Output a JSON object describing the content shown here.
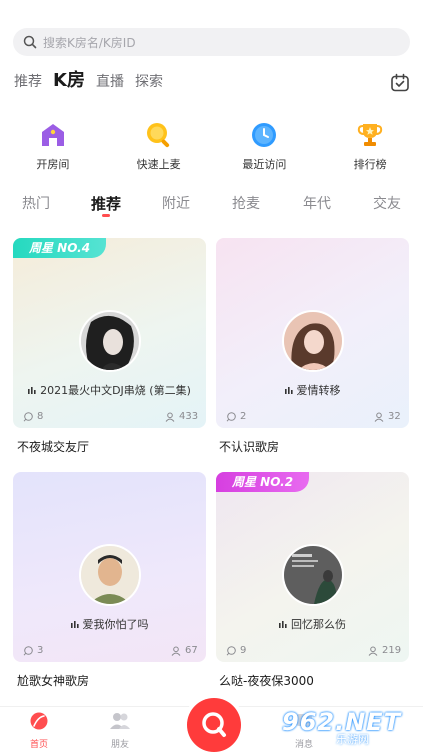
{
  "search": {
    "placeholder": "搜索K房名/K房ID"
  },
  "top_tabs": [
    "推荐",
    "K房",
    "直播",
    "探索"
  ],
  "quick_actions": [
    {
      "label": "开房间",
      "icon": "house-icon"
    },
    {
      "label": "快速上麦",
      "icon": "mic-icon"
    },
    {
      "label": "最近访问",
      "icon": "clock-icon"
    },
    {
      "label": "排行榜",
      "icon": "trophy-icon"
    }
  ],
  "categories": [
    "热门",
    "推荐",
    "附近",
    "抢麦",
    "年代",
    "交友"
  ],
  "rooms": [
    {
      "badge": "周星 NO.4",
      "song": "2021最火中文DJ串烧 (第二集)",
      "comments": "8",
      "listeners": "433",
      "name": "不夜城交友厅"
    },
    {
      "badge": "",
      "song": "爱情转移",
      "comments": "2",
      "listeners": "32",
      "name": "不认识歌房"
    },
    {
      "badge": "",
      "song": "爱我你怕了吗",
      "comments": "3",
      "listeners": "67",
      "name": "尬歌女神歌房"
    },
    {
      "badge": "周星 NO.2",
      "song": "回忆那么伤",
      "comments": "9",
      "listeners": "219",
      "name": "么哒-夜夜保3000"
    }
  ],
  "bottom_nav": {
    "home": "首页",
    "friends": "朋友",
    "messages": "消息"
  },
  "watermark": {
    "brand": "962.NET",
    "sub": "乐游网"
  },
  "colors": {
    "accent": "#ff4d4f",
    "badge_teal": "#25d9bf",
    "badge_pink": "#d63fe0"
  }
}
